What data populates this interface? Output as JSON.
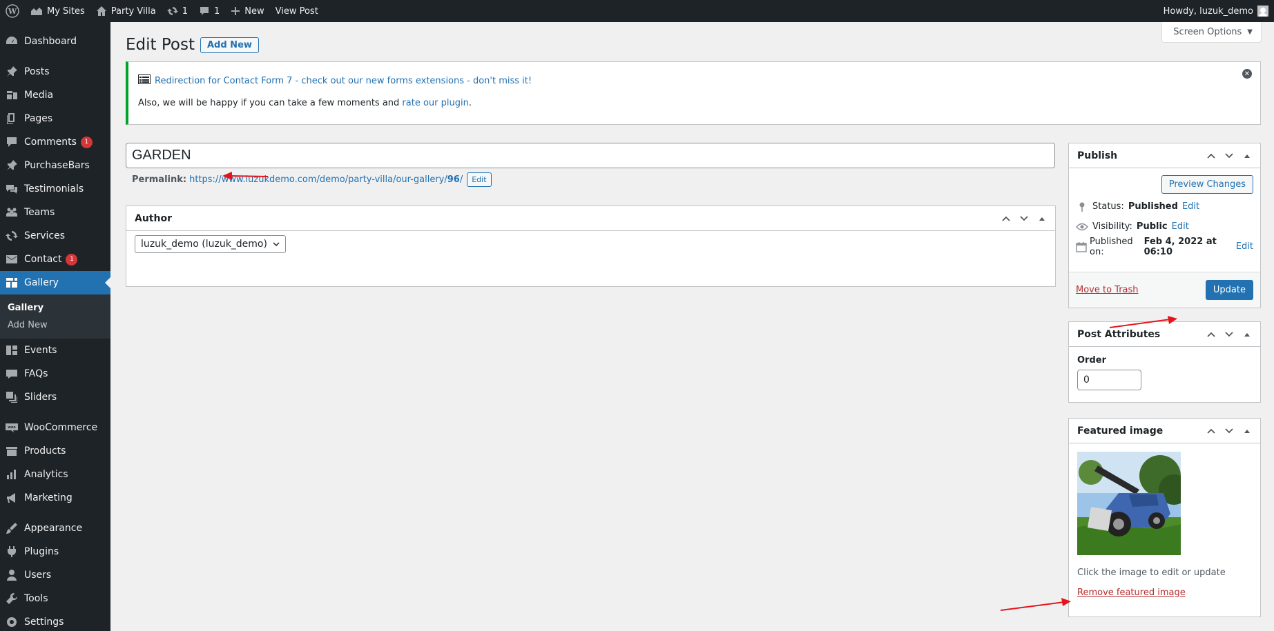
{
  "adminbar": {
    "my_sites": "My Sites",
    "site_name": "Party Villa",
    "updates_count": "1",
    "comments_count": "1",
    "new_label": "New",
    "view_post": "View Post",
    "howdy": "Howdy, luzuk_demo"
  },
  "sidebar": {
    "items": [
      {
        "label": "Dashboard",
        "icon": "dashboard-icon"
      },
      {
        "label": "Posts",
        "icon": "pin-icon"
      },
      {
        "label": "Media",
        "icon": "media-icon"
      },
      {
        "label": "Pages",
        "icon": "pages-icon"
      },
      {
        "label": "Comments",
        "icon": "comments-icon",
        "badge": "1"
      },
      {
        "label": "PurchaseBars",
        "icon": "pin-icon"
      },
      {
        "label": "Testimonials",
        "icon": "testimonials-icon"
      },
      {
        "label": "Teams",
        "icon": "groups-icon"
      },
      {
        "label": "Services",
        "icon": "services-icon"
      },
      {
        "label": "Contact",
        "icon": "mail-icon",
        "badge": "1"
      },
      {
        "label": "Gallery",
        "icon": "gallery-icon"
      },
      {
        "label": "Events",
        "icon": "events-icon"
      },
      {
        "label": "FAQs",
        "icon": "faq-icon"
      },
      {
        "label": "Sliders",
        "icon": "sliders-icon"
      },
      {
        "label": "WooCommerce",
        "icon": "woo-icon"
      },
      {
        "label": "Products",
        "icon": "products-icon"
      },
      {
        "label": "Analytics",
        "icon": "analytics-icon"
      },
      {
        "label": "Marketing",
        "icon": "marketing-icon"
      },
      {
        "label": "Appearance",
        "icon": "appearance-icon"
      },
      {
        "label": "Plugins",
        "icon": "plugins-icon"
      },
      {
        "label": "Users",
        "icon": "users-icon"
      },
      {
        "label": "Tools",
        "icon": "tools-icon"
      },
      {
        "label": "Settings",
        "icon": "settings-icon"
      }
    ],
    "submenu": [
      "Gallery",
      "Add New"
    ]
  },
  "header": {
    "screen_options": "Screen Options",
    "title": "Edit Post",
    "add_new": "Add New"
  },
  "notice": {
    "link_text": "Redirection for Contact Form 7 - check out our new forms extensions - don't miss it!",
    "text_prefix": "Also, we will be happy if you can take a few moments and ",
    "rate_link": "rate our plugin",
    "text_suffix": "."
  },
  "post": {
    "title": "GARDEN",
    "permalink_label": "Permalink:",
    "permalink_url": "https://www.luzukdemo.com/demo/party-villa/our-gallery/",
    "permalink_slug": "96",
    "permalink_end": "/",
    "edit_label": "Edit"
  },
  "author_box": {
    "title": "Author",
    "selected": "luzuk_demo (luzuk_demo)"
  },
  "publish_box": {
    "title": "Publish",
    "preview": "Preview Changes",
    "status_label": "Status:",
    "status_value": "Published",
    "visibility_label": "Visibility:",
    "visibility_value": "Public",
    "published_label": "Published on:",
    "published_value": "Feb 4, 2022 at 06:10",
    "edit": "Edit",
    "trash": "Move to Trash",
    "update": "Update"
  },
  "attributes_box": {
    "title": "Post Attributes",
    "order_label": "Order",
    "order_value": "0"
  },
  "featured_box": {
    "title": "Featured image",
    "hint": "Click the image to edit or update",
    "remove": "Remove featured image"
  },
  "colors": {
    "accent": "#2271b1",
    "sidebar_bg": "#1d2327",
    "notice_border": "#00a32a",
    "badge": "#d63638",
    "annotation_arrow": "#e3141b"
  }
}
